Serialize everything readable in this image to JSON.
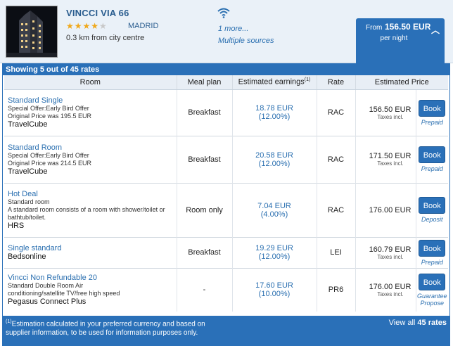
{
  "hotel": {
    "name": "VINCCI VIA 66",
    "city": "MADRID",
    "distance": "0.3 km from city centre",
    "stars_on": "★★★★",
    "stars_off": "★",
    "star_rating": 4,
    "more_label": "1 more...",
    "sources_label": "Multiple sources",
    "price_from_label": "From",
    "price_value": "156.50 EUR",
    "price_per": "per night"
  },
  "rates": {
    "showing_prefix": "Showing 5 out of ",
    "showing_count": "45 rates",
    "columns": {
      "room": "Room",
      "meal": "Meal plan",
      "earnings": "Estimated earnings",
      "earnings_sup": "(1)",
      "rate": "Rate",
      "price": "Estimated Price"
    },
    "rows": [
      {
        "name": "Standard Single",
        "desc1": "Special Offer:Early Bird Offer",
        "desc2": "Original Price was 195.5 EUR",
        "source": "TravelCube",
        "meal": "Breakfast",
        "earn": "18.78 EUR",
        "earn_pct": "(12.00%)",
        "rate": "RAC",
        "price": "156.50 EUR",
        "tax": "Taxes incl.",
        "book": "Book",
        "book_sub": "Prepaid"
      },
      {
        "name": "Standard Room",
        "desc1": "Special Offer:Early Bird Offer",
        "desc2": "Original Price was 214.5 EUR",
        "source": "TravelCube",
        "meal": "Breakfast",
        "earn": "20.58 EUR",
        "earn_pct": "(12.00%)",
        "rate": "RAC",
        "price": "171.50 EUR",
        "tax": "Taxes incl.",
        "book": "Book",
        "book_sub": "Prepaid"
      },
      {
        "name": "Hot Deal",
        "desc1": "Standard room",
        "desc2": "A standard room consists of a room with shower/toilet or bathtub/toilet.",
        "source": "HRS",
        "meal": "Room only",
        "earn": "7.04 EUR",
        "earn_pct": "(4.00%)",
        "rate": "RAC",
        "price": "176.00 EUR",
        "tax": "",
        "book": "Book",
        "book_sub": "Deposit"
      },
      {
        "name": "Single standard",
        "desc1": "",
        "desc2": "",
        "source": "Bedsonline",
        "meal": "Breakfast",
        "earn": "19.29 EUR",
        "earn_pct": "(12.00%)",
        "rate": "LEI",
        "price": "160.79 EUR",
        "tax": "Taxes incl.",
        "book": "Book",
        "book_sub": "Prepaid"
      },
      {
        "name": "Vincci Non Refundable 20",
        "desc1": "Standard Double Room Air",
        "desc2": "conditioning/satellite TV/free high speed",
        "source": "Pegasus Connect Plus",
        "meal": "-",
        "earn": "17.60 EUR",
        "earn_pct": "(10.00%)",
        "rate": "PR6",
        "price": "176.00 EUR",
        "tax": "Taxes incl.",
        "book": "Book",
        "book_sub": "Guarantee Propose"
      }
    ]
  },
  "footer": {
    "note_sup": "(1)",
    "note": "Estimation calculated in your preferred currency and based on supplier information, to be used for information purposes only.",
    "view_all_prefix": "View all ",
    "view_all_count": "45 rates"
  },
  "colors": {
    "accent": "#2a70b8",
    "link": "#2a6fb0",
    "star": "#f0a81a",
    "header_bg": "#eaf1f8"
  }
}
